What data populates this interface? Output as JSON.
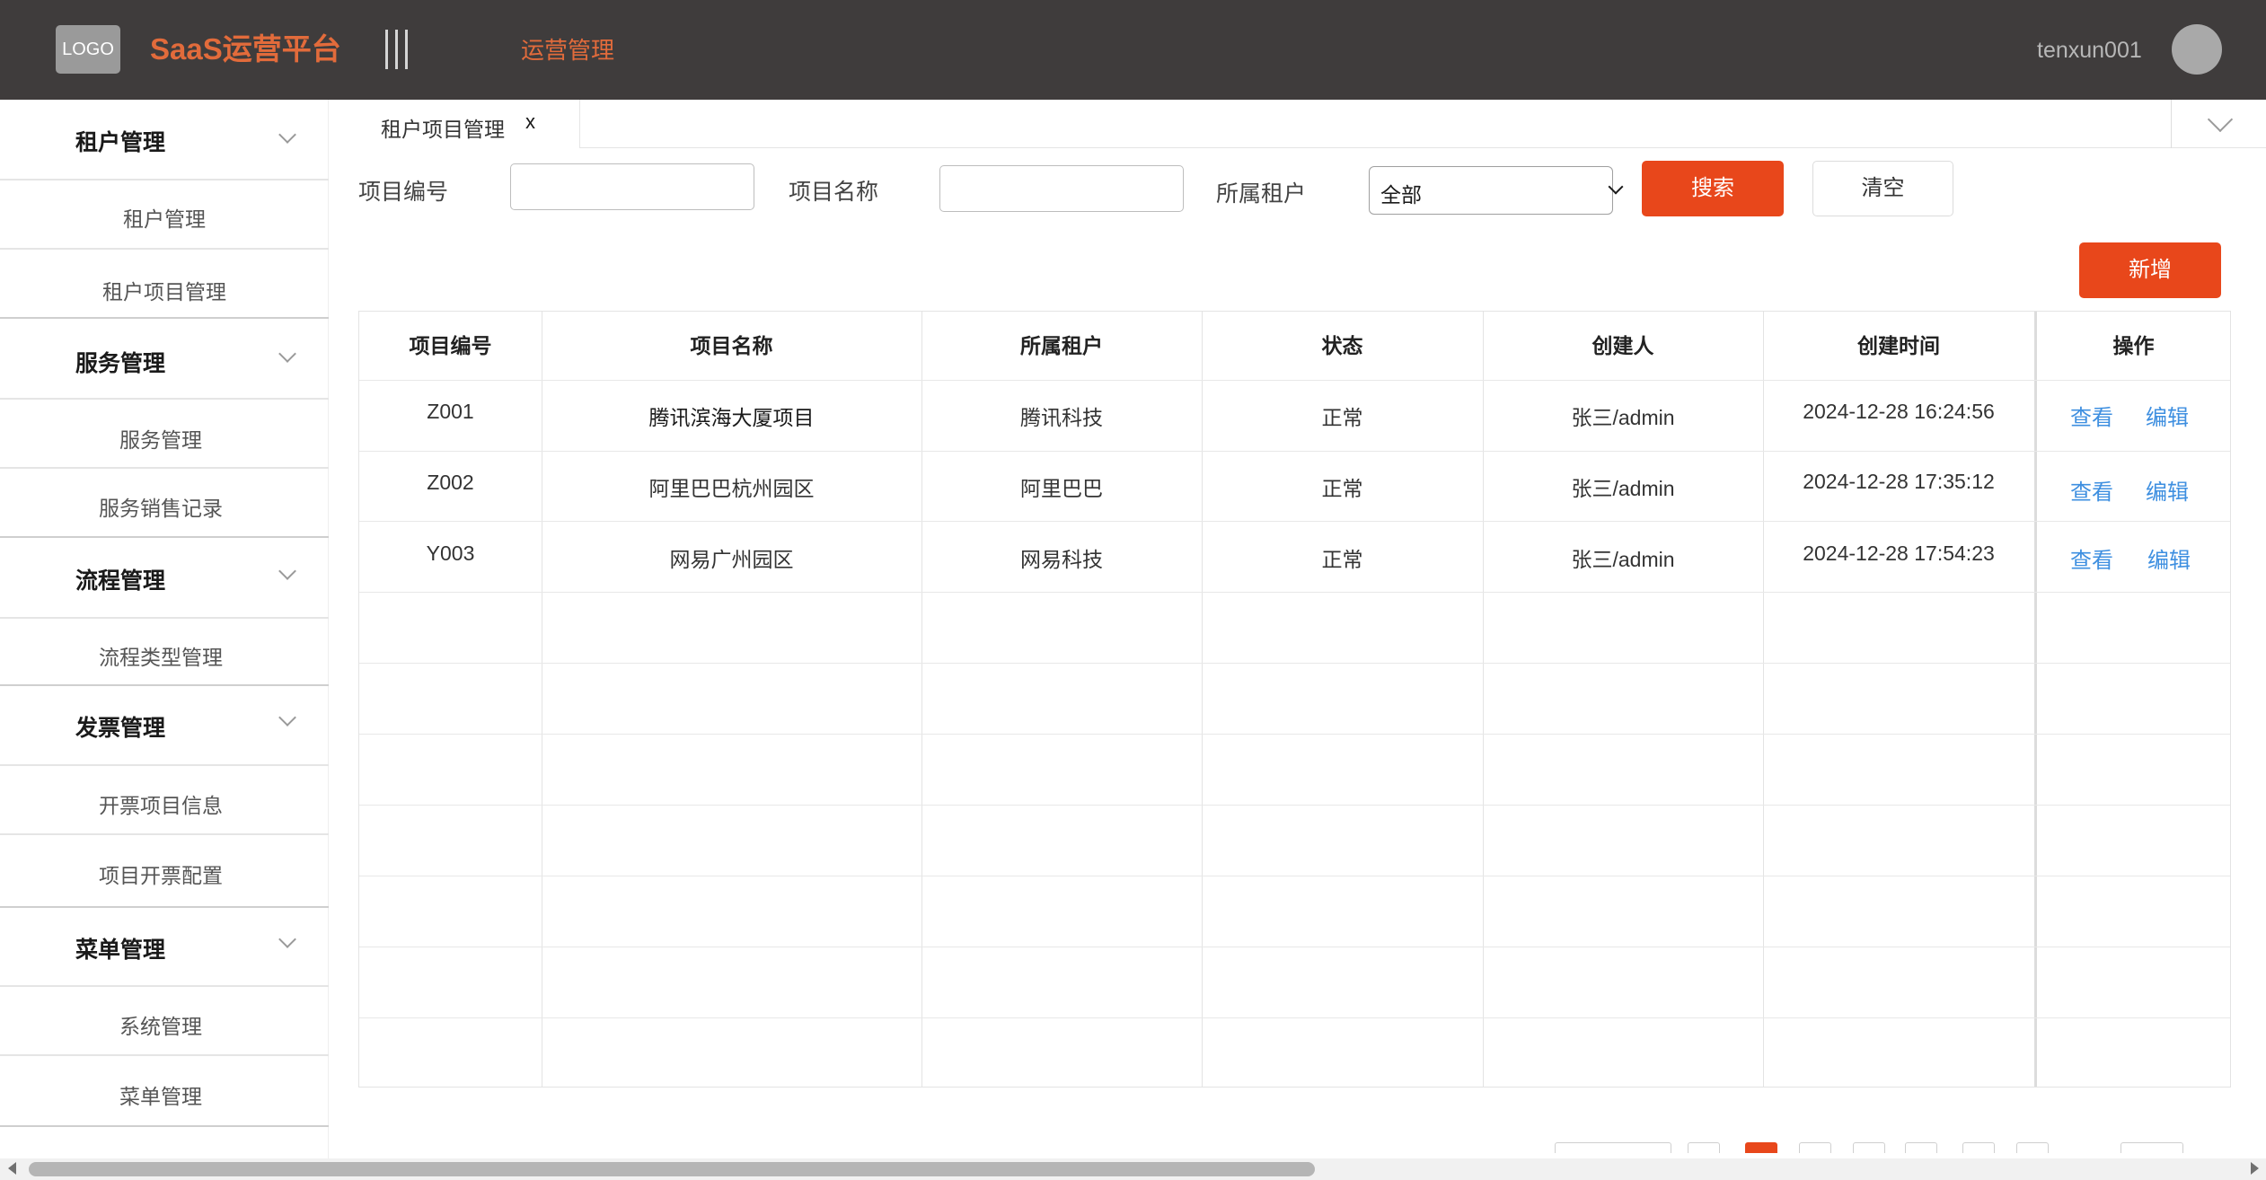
{
  "header": {
    "logo_text": "LOGO",
    "app_title": "SaaS运营平台",
    "nav_item": "运营管理",
    "username": "tenxun001"
  },
  "sidebar": {
    "groups": [
      {
        "label": "租户管理",
        "items": [
          "租户管理",
          "租户项目管理"
        ]
      },
      {
        "label": "服务管理",
        "items": [
          "服务管理",
          "服务销售记录"
        ]
      },
      {
        "label": "流程管理",
        "items": [
          "流程类型管理"
        ]
      },
      {
        "label": "发票管理",
        "items": [
          "开票项目信息",
          "项目开票配置"
        ]
      },
      {
        "label": "菜单管理",
        "items": [
          "系统管理",
          "菜单管理"
        ]
      }
    ]
  },
  "tabs": [
    {
      "label": "租户项目管理",
      "close": "x"
    }
  ],
  "search": {
    "code_label": "项目编号",
    "code_value": "",
    "name_label": "项目名称",
    "name_value": "",
    "tenant_label": "所属租户",
    "tenant_selected": "全部",
    "search_button": "搜索",
    "clear_button": "清空"
  },
  "actions": {
    "add_button": "新增"
  },
  "table": {
    "columns": [
      "项目编号",
      "项目名称",
      "所属租户",
      "状态",
      "创建人",
      "创建时间",
      "操作"
    ],
    "rows": [
      {
        "code": "Z001",
        "name": "腾讯滨海大厦项目",
        "tenant": "腾讯科技",
        "status": "正常",
        "creator": "张三/admin",
        "created_at": "2024-12-28 16:24:56",
        "view": "查看",
        "edit": "编辑"
      },
      {
        "code": "Z002",
        "name": "阿里巴巴杭州园区",
        "tenant": "阿里巴巴",
        "status": "正常",
        "creator": "张三/admin",
        "created_at": "2024-12-28 17:35:12",
        "view": "查看",
        "edit": "编辑"
      },
      {
        "code": "Y003",
        "name": "网易广州园区",
        "tenant": "网易科技",
        "status": "正常",
        "creator": "张三/admin",
        "created_at": "2024-12-28 17:54:23",
        "view": "查看",
        "edit": "编辑"
      }
    ]
  },
  "colors": {
    "header_bg": "#3f3c3c",
    "brand_orange": "#e26b3b",
    "primary_button": "#e8471b",
    "pager_active": "#e8471b",
    "link_blue": "#3e8fe0"
  }
}
